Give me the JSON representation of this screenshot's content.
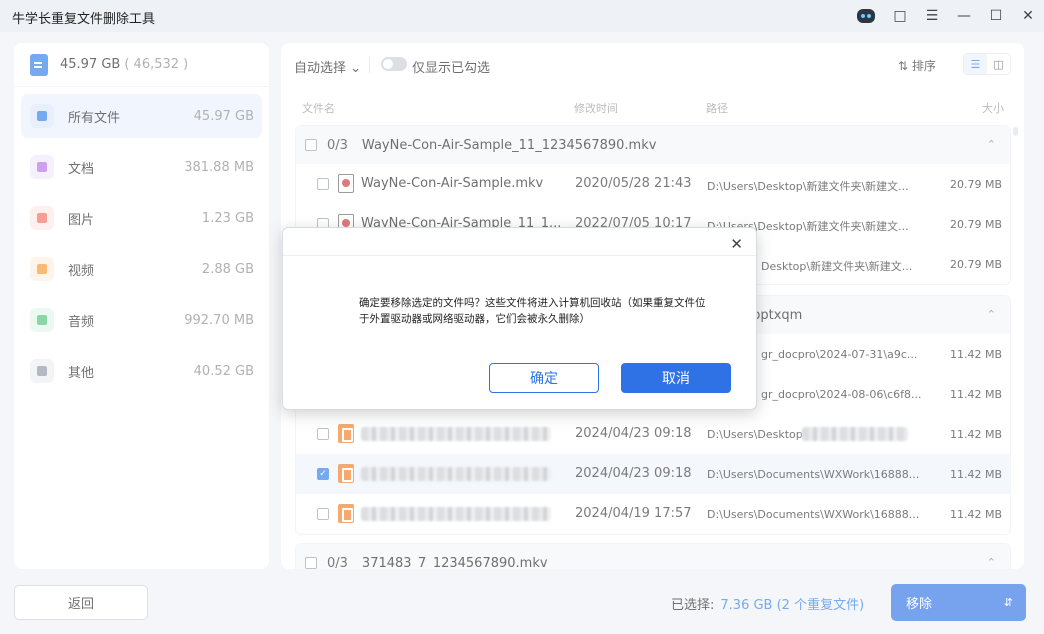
{
  "app": {
    "title": "牛学长重复文件删除工具"
  },
  "window_controls": [
    "robot-icon",
    "feedback-icon",
    "menu-icon",
    "minimize-icon",
    "maximize-icon",
    "close-icon"
  ],
  "summary": {
    "size": "45.97 GB",
    "count": "( 46,532 )"
  },
  "categories": [
    {
      "label": "所有文件",
      "size": "45.97 GB",
      "icon": "all-files-icon",
      "color": "#2b7de9",
      "bg": "#dbe8fb"
    },
    {
      "label": "文档",
      "size": "381.88 MB",
      "icon": "document-icon",
      "color": "#b46ee6",
      "bg": "#f1e6fb"
    },
    {
      "label": "图片",
      "size": "1.23 GB",
      "icon": "image-icon",
      "color": "#f06a5a",
      "bg": "#fde8e5"
    },
    {
      "label": "视频",
      "size": "2.88 GB",
      "icon": "video-icon",
      "color": "#f5962a",
      "bg": "#fdeedd"
    },
    {
      "label": "音频",
      "size": "992.70 MB",
      "icon": "audio-icon",
      "color": "#4cc174",
      "bg": "#e2f6e9"
    },
    {
      "label": "其他",
      "size": "40.52 GB",
      "icon": "other-icon",
      "color": "#8a93a1",
      "bg": "#eceef2"
    }
  ],
  "toolbar": {
    "auto_select": "自动选择",
    "show_checked": "仅显示已勾选",
    "sort": "排序"
  },
  "columns": {
    "name": "文件名",
    "modified": "修改时间",
    "path": "路径",
    "size": "大小"
  },
  "groups": [
    {
      "count": "0/3",
      "name": "WayNe-Con-Air-Sample_11_1234567890.mkv",
      "rows": [
        {
          "name": "WayNe-Con-Air-Sample.mkv",
          "date": "2020/05/28 21:43",
          "path": "D:\\Users\\Desktop\\新建文件夹\\新建文...",
          "size": "20.79 MB"
        },
        {
          "name": "WayNe-Con-Air-Sample_11_1...",
          "date": "2022/07/05 10:17",
          "path": "D:\\Users\\Desktop\\新建文件夹\\新建文...",
          "size": "20.79 MB"
        },
        {
          "name": "",
          "date": "",
          "path": "Desktop\\新建文件夹\\新建文...",
          "size": "20.79 MB"
        }
      ]
    },
    {
      "name_tail": ".pptxqm",
      "rows": [
        {
          "path": "gr_docpro\\2024-07-31\\a9c...",
          "size": "11.42 MB"
        },
        {
          "path": "gr_docpro\\2024-08-06\\c6f8...",
          "size": "11.42 MB"
        },
        {
          "date": "2024/04/23 09:18",
          "path": "D:\\Users\\Desktop\\",
          "size": "11.42 MB"
        },
        {
          "date": "2024/04/23 09:18",
          "path": "D:\\Users\\Documents\\WXWork\\16888...",
          "size": "11.42 MB"
        },
        {
          "date": "2024/04/19 17:57",
          "path": "D:\\Users\\Documents\\WXWork\\16888...",
          "size": "11.42 MB"
        }
      ]
    },
    {
      "count": "0/3",
      "name": "371483_7_1234567890.mkv"
    }
  ],
  "footer": {
    "back": "返回",
    "selected_label": "已选择:",
    "selected_value": "7.36 GB (2 个重复文件)",
    "remove": "移除"
  },
  "dialog": {
    "message": "确定要移除选定的文件吗？这些文件将进入计算机回收站（如果重复文件位于外置驱动器或网络驱动器，它们会被永久删除）",
    "confirm": "确定",
    "cancel": "取消"
  }
}
